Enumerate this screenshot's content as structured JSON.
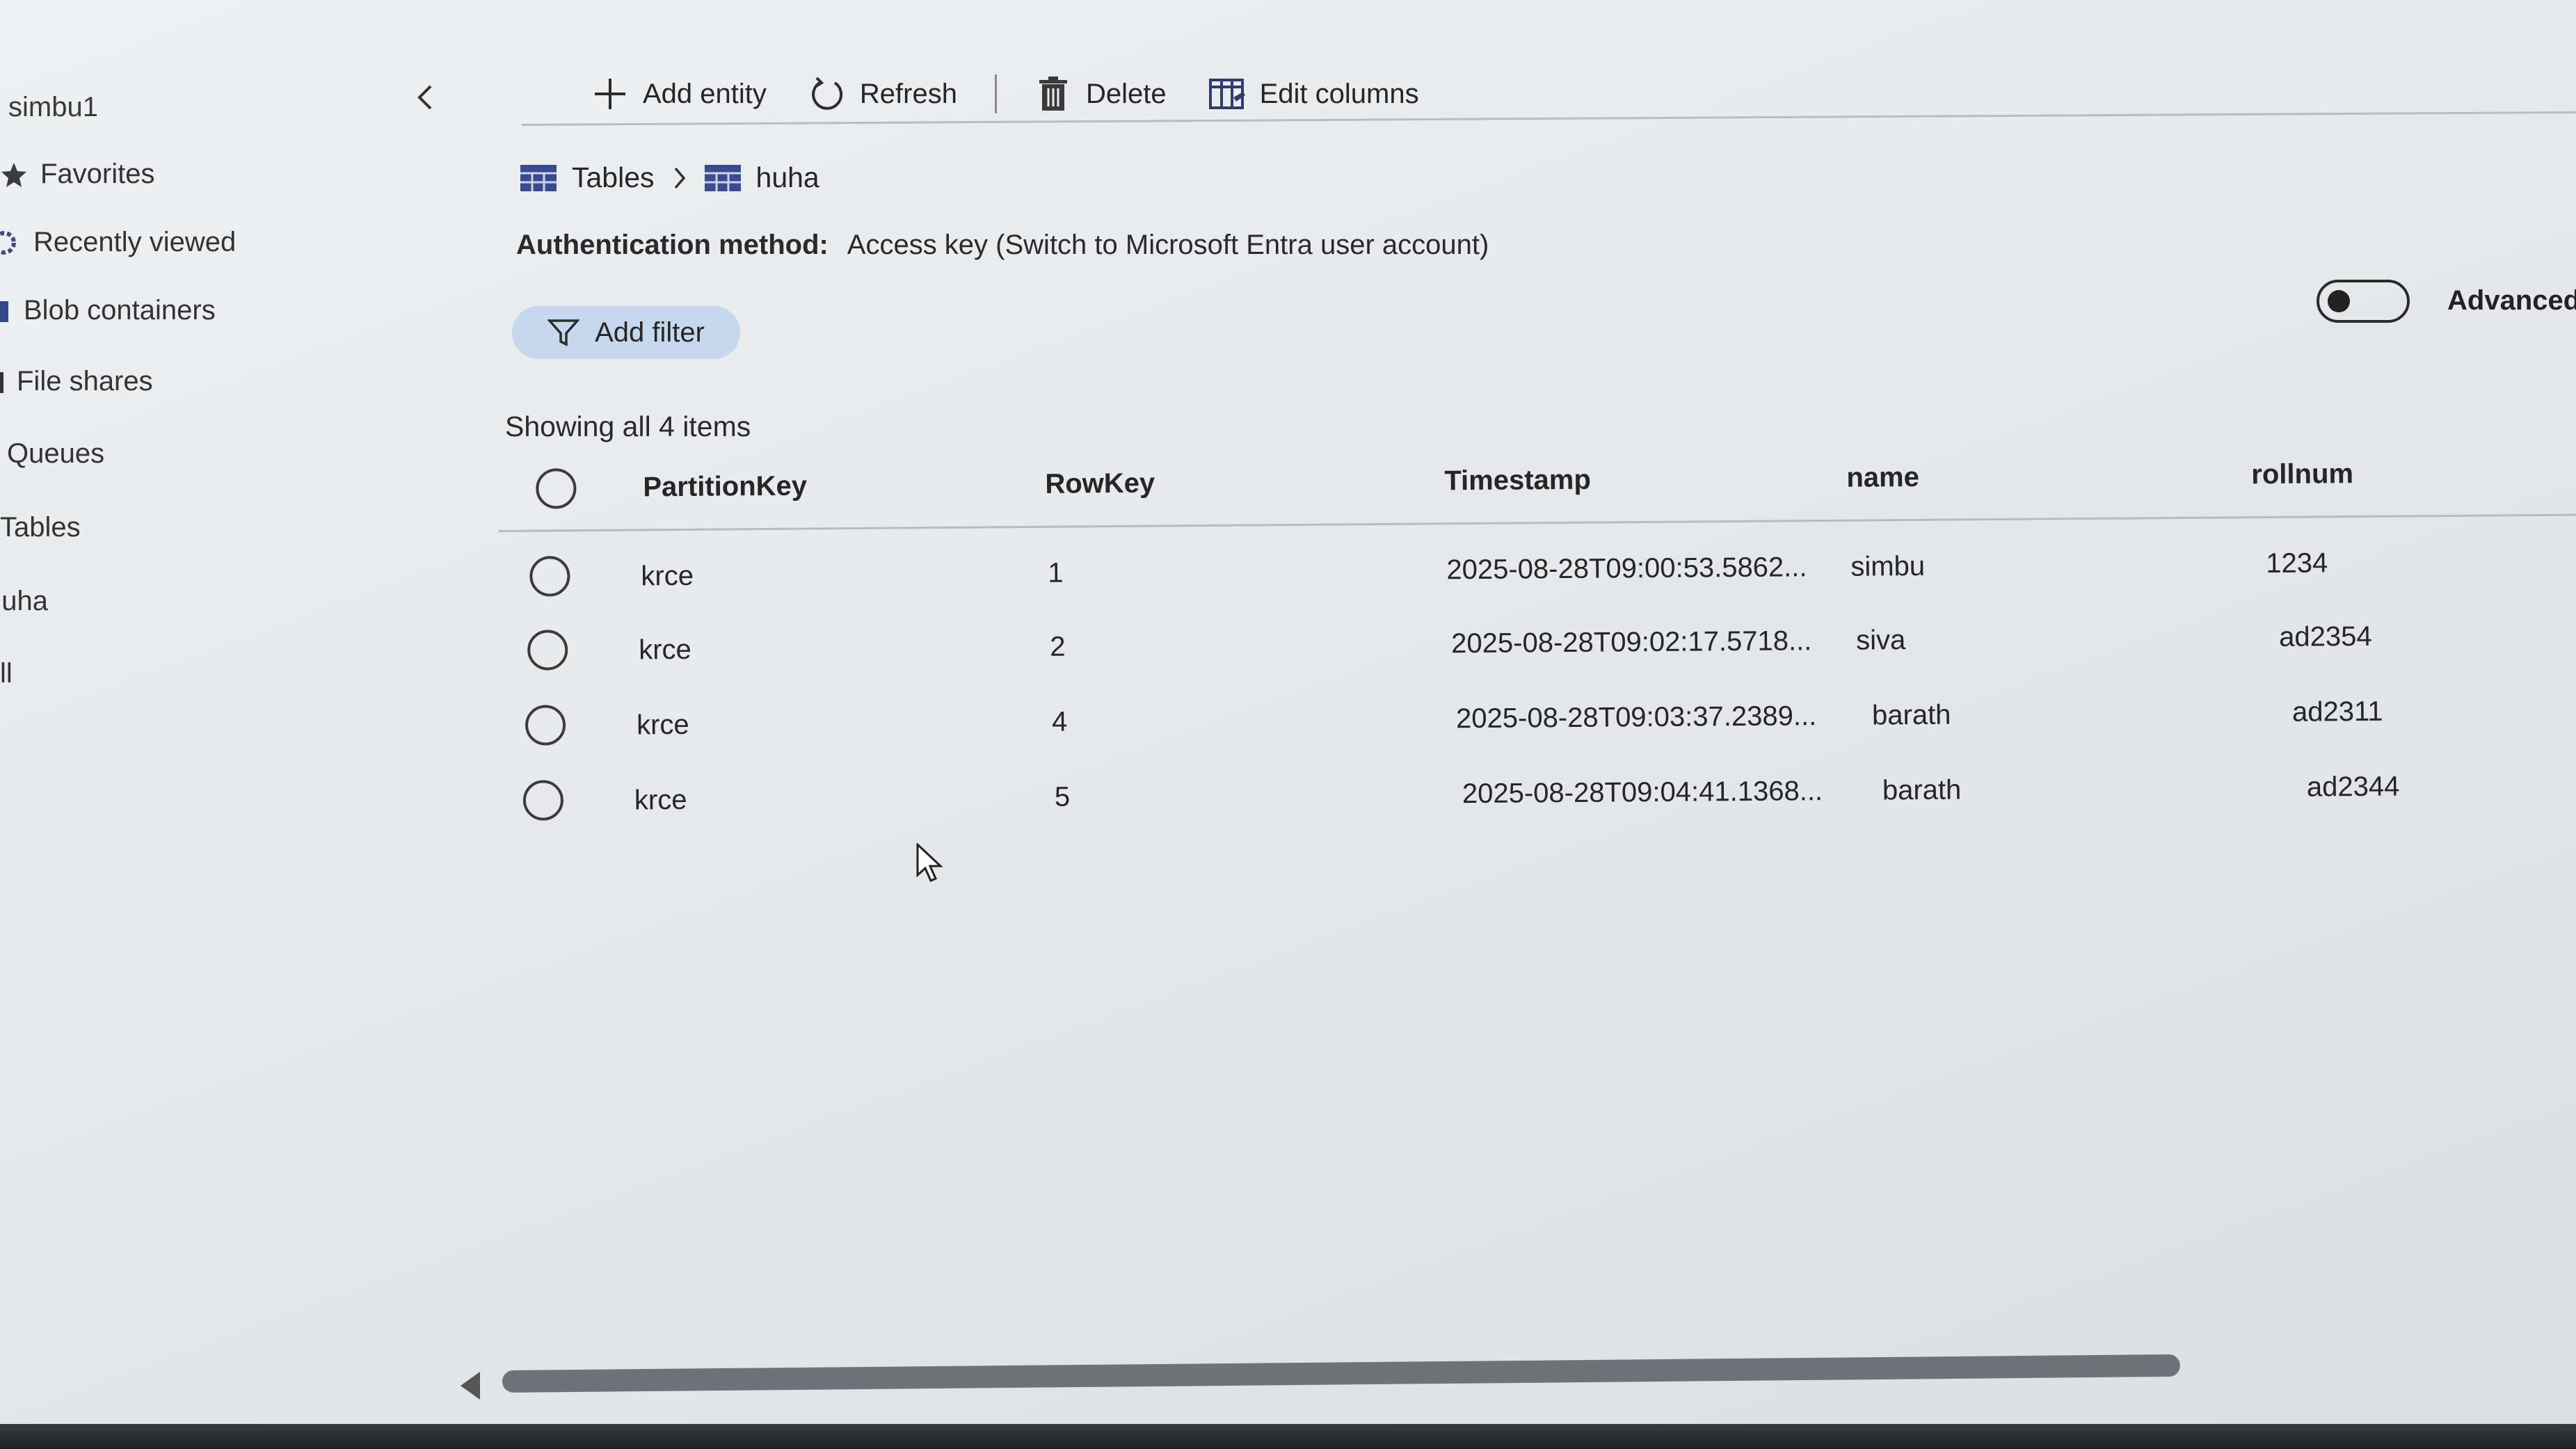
{
  "sidebar": {
    "account": "simbu1",
    "items": [
      {
        "label": "Favorites",
        "icon": "star-icon"
      },
      {
        "label": "Recently viewed",
        "icon": "gear-icon"
      },
      {
        "label": "Blob containers",
        "icon": "container-icon"
      },
      {
        "label": "File shares",
        "icon": "file-share-icon"
      },
      {
        "label": "Queues",
        "icon": "queue-icon"
      },
      {
        "label": "Tables",
        "icon": "table-icon"
      },
      {
        "label": "nuha",
        "icon": "table-icon"
      },
      {
        "label": "ll",
        "icon": "table-icon"
      }
    ]
  },
  "toolbar": {
    "add_entity_label": "Add entity",
    "refresh_label": "Refresh",
    "delete_label": "Delete",
    "edit_columns_label": "Edit columns"
  },
  "breadcrumb": {
    "root": "Tables",
    "current": "huha"
  },
  "auth": {
    "label": "Authentication method:",
    "value": "Access key (Switch to Microsoft Entra user account)"
  },
  "filter": {
    "label": "Add filter"
  },
  "advanced": {
    "label": "Advanced",
    "enabled": false
  },
  "table": {
    "count_text": "Showing all 4 items",
    "columns": [
      "PartitionKey",
      "RowKey",
      "Timestamp",
      "name",
      "rollnum"
    ],
    "rows": [
      {
        "partition": "krce",
        "rowkey": "1",
        "timestamp": "2025-08-28T09:00:53.5862...",
        "name": "simbu",
        "rollnum": "1234"
      },
      {
        "partition": "krce",
        "rowkey": "2",
        "timestamp": "2025-08-28T09:02:17.5718...",
        "name": "siva",
        "rollnum": "ad2354"
      },
      {
        "partition": "krce",
        "rowkey": "4",
        "timestamp": "2025-08-28T09:03:37.2389...",
        "name": "barath",
        "rollnum": "ad2311"
      },
      {
        "partition": "krce",
        "rowkey": "5",
        "timestamp": "2025-08-28T09:04:41.1368...",
        "name": "barath",
        "rollnum": "ad2344"
      }
    ]
  },
  "colors": {
    "filter_bg": "#c5d8ee",
    "text": "#262626",
    "table_icon_accent": "#3b4a8c"
  }
}
